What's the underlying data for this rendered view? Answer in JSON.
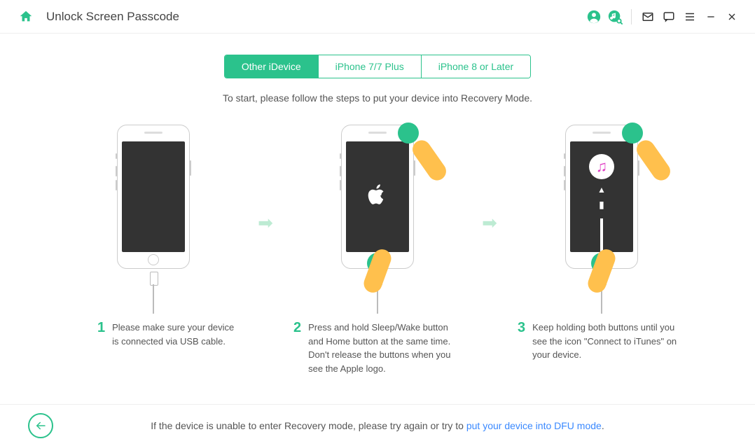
{
  "header": {
    "title": "Unlock Screen Passcode"
  },
  "tabs": {
    "t1": "Other iDevice",
    "t2": "iPhone 7/7 Plus",
    "t3": "iPhone 8 or Later"
  },
  "instruction": "To start, please follow the steps to put your device into Recovery Mode.",
  "steps": {
    "s1": {
      "num": "1",
      "text": "Please make sure your device is connected via USB cable."
    },
    "s2": {
      "num": "2",
      "text": "Press and hold Sleep/Wake button and Home button at the same time. Don't release the buttons when you see the Apple logo."
    },
    "s3": {
      "num": "3",
      "text": "Keep holding both buttons until you see the icon \"Connect to iTunes\" on your device."
    }
  },
  "footer": {
    "pre": "If the device is unable to enter Recovery mode, please try again or try to ",
    "link": "put your device into DFU mode",
    "post": "."
  }
}
